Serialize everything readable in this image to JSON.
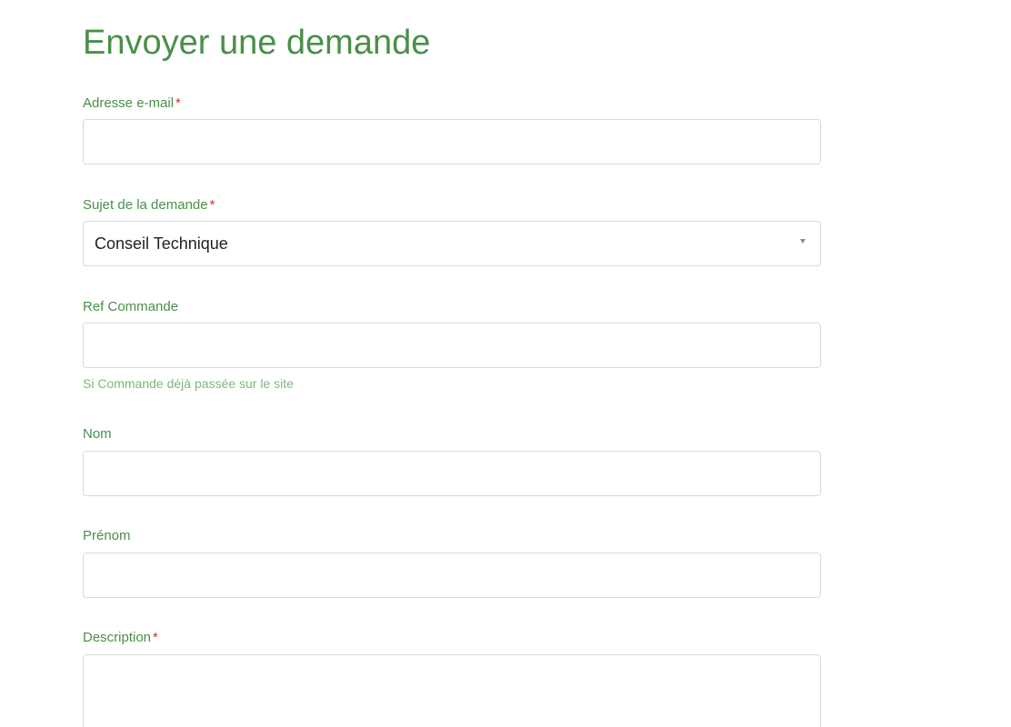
{
  "form": {
    "title": "Envoyer une demande",
    "required_marker": "*",
    "fields": {
      "email": {
        "label": "Adresse e-mail",
        "value": "",
        "placeholder": ""
      },
      "subject": {
        "label": "Sujet de la demande",
        "selected": "Conseil Technique"
      },
      "order_ref": {
        "label": "Ref Commande",
        "value": "",
        "placeholder": "",
        "hint": "Si Commande déjà passée sur le site"
      },
      "last_name": {
        "label": "Nom",
        "value": "",
        "placeholder": ""
      },
      "first_name": {
        "label": "Prénom",
        "value": "",
        "placeholder": ""
      },
      "description": {
        "label": "Description",
        "value": "",
        "placeholder": ""
      }
    }
  },
  "colors": {
    "label": "#4a8f48",
    "required": "#c0392b",
    "hint": "#7fb57d",
    "border": "#d9d9d9"
  },
  "icons": {
    "select_caret": "caret-down-icon"
  }
}
